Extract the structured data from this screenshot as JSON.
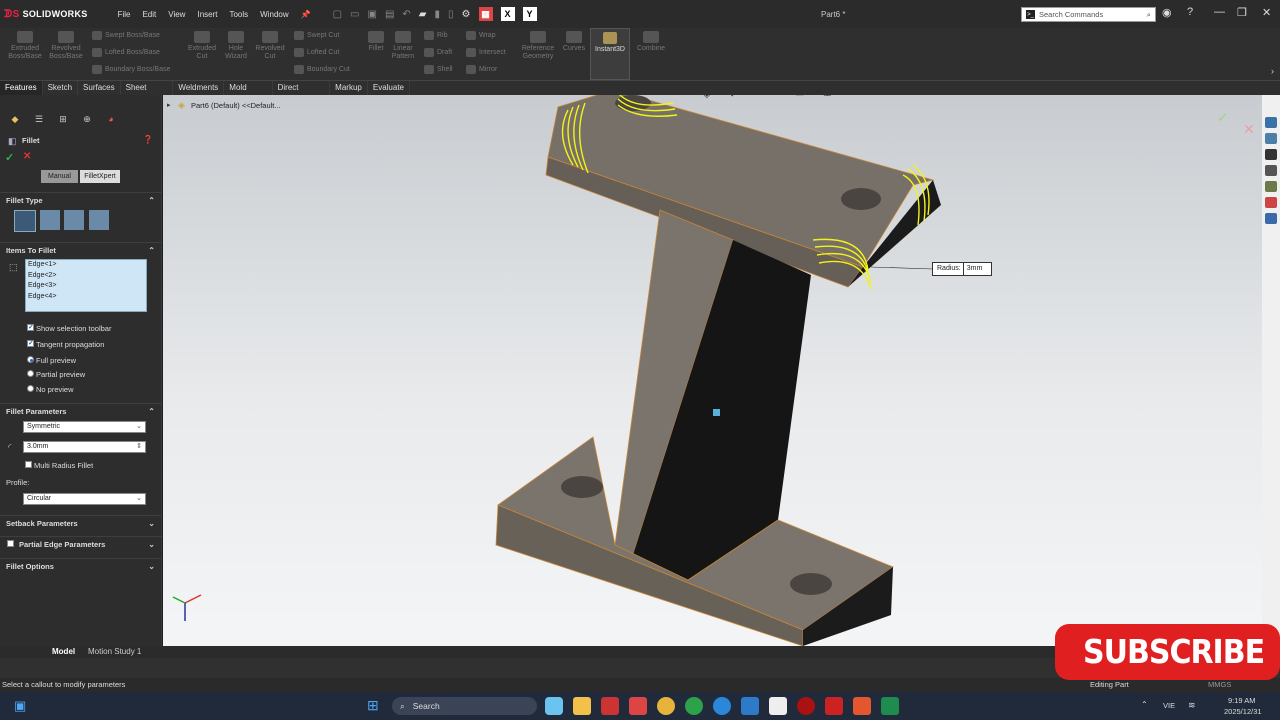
{
  "app": {
    "name": "SOLIDWORKS",
    "doc_title": "Part6 *"
  },
  "menu": [
    "File",
    "Edit",
    "View",
    "Insert",
    "Tools",
    "Window"
  ],
  "quick_access": {
    "x_label": "X",
    "y_label": "Y"
  },
  "search_commands": {
    "placeholder": "Search Commands"
  },
  "command_manager": {
    "features": [
      {
        "label": "Extruded Boss/Base"
      },
      {
        "label": "Revolved Boss/Base"
      },
      {
        "label": "Swept Boss/Base"
      },
      {
        "label": "Lofted Boss/Base"
      },
      {
        "label": "Boundary Boss/Base"
      },
      {
        "label": "Extruded Cut"
      },
      {
        "label": "Hole Wizard"
      },
      {
        "label": "Revolved Cut"
      },
      {
        "label": "Swept Cut"
      },
      {
        "label": "Lofted Cut"
      },
      {
        "label": "Boundary Cut"
      },
      {
        "label": "Fillet"
      },
      {
        "label": "Linear Pattern"
      },
      {
        "label": "Rib"
      },
      {
        "label": "Draft"
      },
      {
        "label": "Shell"
      },
      {
        "label": "Wrap"
      },
      {
        "label": "Intersect"
      },
      {
        "label": "Mirror"
      },
      {
        "label": "Reference Geometry"
      },
      {
        "label": "Curves"
      },
      {
        "label": "Instant3D"
      },
      {
        "label": "Combine"
      }
    ]
  },
  "tabs": [
    "Features",
    "Sketch",
    "Surfaces",
    "Sheet Metal",
    "Weldments",
    "Mold Tools",
    "Direct Editing",
    "Markup",
    "Evaluate"
  ],
  "feature_tree": {
    "root": "Part6 (Default) <<Default..."
  },
  "property_manager": {
    "title": "Fillet",
    "modes": [
      "Manual",
      "FilletXpert"
    ],
    "fillet_type": {
      "heading": "Fillet Type"
    },
    "items_to_fillet": {
      "heading": "Items To Fillet",
      "edges": [
        "Edge<1>",
        "Edge<2>",
        "Edge<3>",
        "Edge<4>"
      ],
      "show_selection_toolbar": "Show selection toolbar",
      "tangent_propagation": "Tangent propagation",
      "full_preview": "Full preview",
      "partial_preview": "Partial preview",
      "no_preview": "No preview"
    },
    "fillet_parameters": {
      "heading": "Fillet Parameters",
      "method": "Symmetric",
      "radius": "3.0mm",
      "multi_radius": "Multi Radius Fillet",
      "profile_label": "Profile:",
      "profile": "Circular"
    },
    "setback_parameters": "Setback Parameters",
    "partial_edge_parameters": "Partial Edge Parameters",
    "fillet_options": "Fillet Options"
  },
  "callout": {
    "label": "Radius:",
    "value": "3mm"
  },
  "bottom_tabs": [
    "Model",
    "Motion Study 1"
  ],
  "status": {
    "message": "Select a callout to modify parameters",
    "mode": "Editing Part",
    "units": "MMGS"
  },
  "taskbar": {
    "search": "Search",
    "lang": "VIE",
    "time": "9:19 AM",
    "date": "2025/12/31"
  },
  "overlay": {
    "subscribe": "SUBSCRIBE"
  },
  "colors": {
    "accent": "#1b6ad6",
    "selection_yellow": "#f3f316",
    "edge_orange": "#e08a2a",
    "subscribe_red": "#e02020"
  }
}
